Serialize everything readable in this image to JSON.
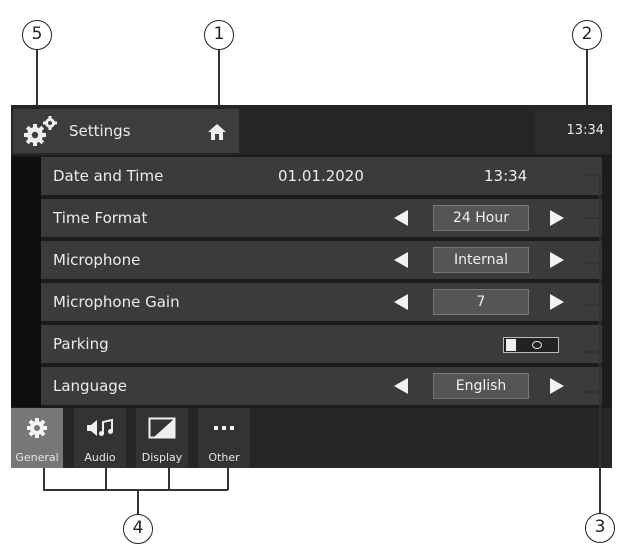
{
  "callouts": [
    "1",
    "2",
    "3",
    "4",
    "5"
  ],
  "header": {
    "title": "Settings",
    "time": "13:34",
    "gear_icon": "gear-icon",
    "home_icon": "home-icon"
  },
  "rows": [
    {
      "label": "Date and Time",
      "date": "01.01.2020",
      "time": "13:34"
    },
    {
      "label": "Time Format",
      "value": "24 Hour"
    },
    {
      "label": "Microphone",
      "value": "Internal"
    },
    {
      "label": "Microphone Gain",
      "value": "7"
    },
    {
      "label": "Parking",
      "toggle": "off"
    },
    {
      "label": "Language",
      "value": "English"
    }
  ],
  "tabs": [
    {
      "label": "General",
      "icon": "gear-icon",
      "active": true
    },
    {
      "label": "Audio",
      "icon": "audio-icon",
      "active": false
    },
    {
      "label": "Display",
      "icon": "display-icon",
      "active": false
    },
    {
      "label": "Other",
      "icon": "more-icon",
      "active": false
    }
  ]
}
